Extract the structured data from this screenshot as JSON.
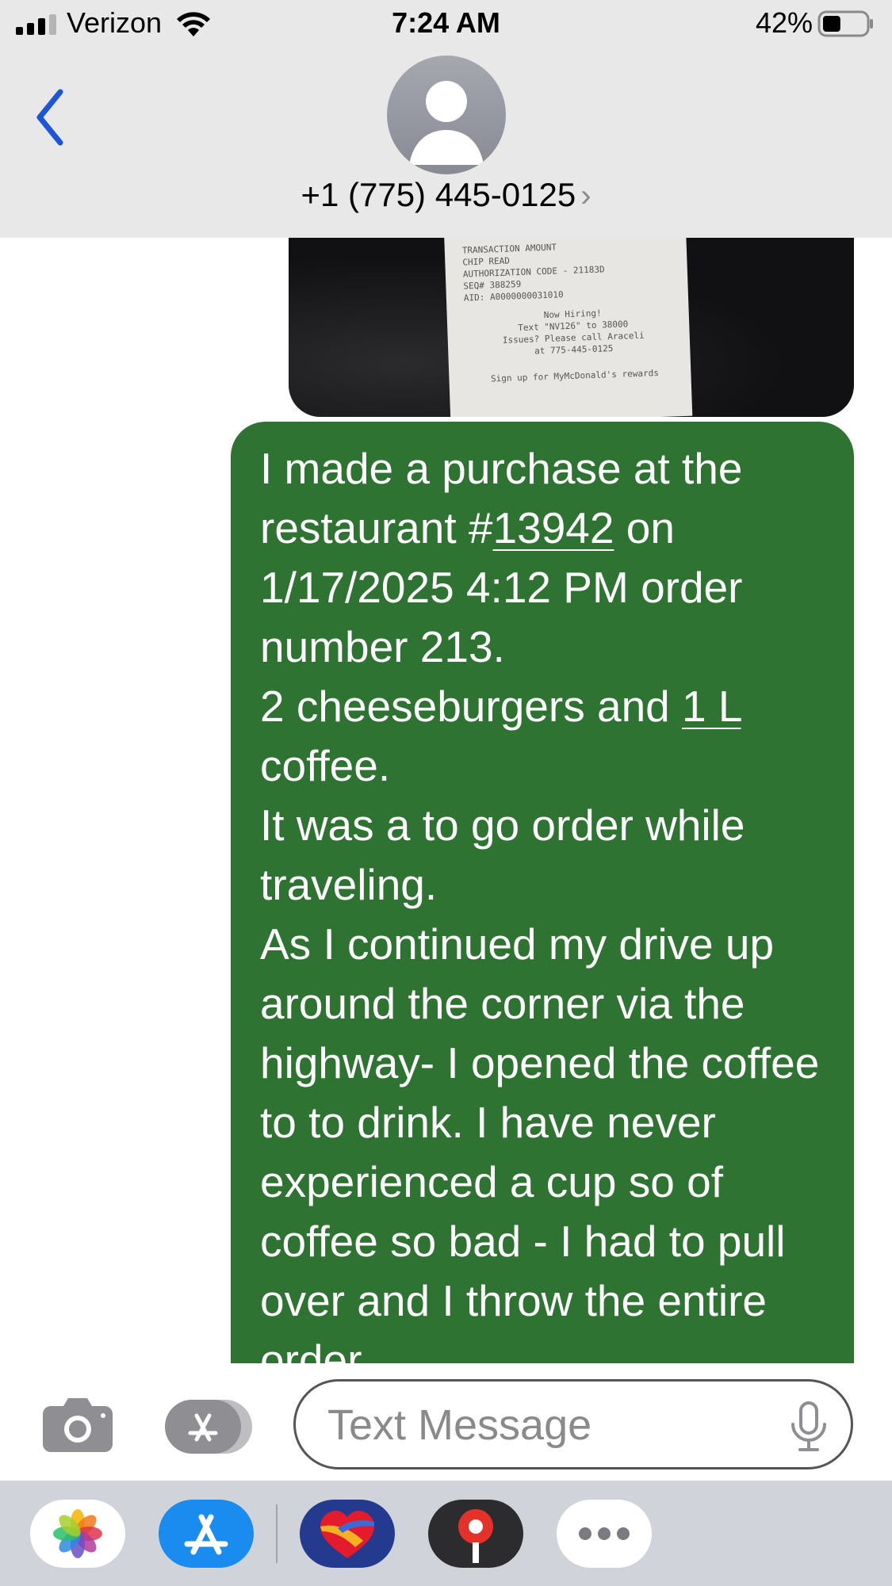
{
  "status_bar": {
    "carrier": "Verizon",
    "time": "7:24 AM",
    "battery_percent": "42%",
    "battery_level": 0.42
  },
  "header": {
    "contact": "+1 (775) 445-0125",
    "chevron": "›",
    "back_icon": "chevron-left-icon"
  },
  "thread": {
    "image_message": {
      "receipt_lines": [
        "TRANSACTION AMOUNT",
        "CHIP READ",
        "AUTHORIZATION CODE - 21183D",
        "SEQ# 388259",
        "AID: A0000000031010",
        "Now Hiring!",
        "Text \"NV126\" to 38000",
        "Issues? Please call Araceli",
        "at 775-445-0125",
        "Sign up for MyMcDonald's rewards"
      ]
    },
    "text_message": {
      "p1_a": "I made a purchase at the restaurant #",
      "p1_link": "13942",
      "p1_b": " on 1/17/2025 4:12 PM order number 213.",
      "p2_a": "2 cheeseburgers and ",
      "p2_link": "1 L",
      "p2_b": " coffee.",
      "p3": "It was a to go order while traveling.",
      "p4": "As I continued my drive up around the corner via the highway- I opened the coffee to to drink. I have never experienced a cup so of coffee so bad - I had to pull over and I throw the entire order"
    }
  },
  "input_bar": {
    "placeholder": "Text Message",
    "camera_icon": "camera-icon",
    "apps_icon": "app-store-icon",
    "mic_icon": "microphone-icon"
  },
  "app_drawer": {
    "apps": [
      "photos-icon",
      "app-store-icon",
      "southwest-icon",
      "maps-pin-icon",
      "more-icon"
    ]
  },
  "colors": {
    "bubble": "#2e7331",
    "accent_blue": "#1c55d6",
    "header_bg": "#e8e8e8"
  }
}
